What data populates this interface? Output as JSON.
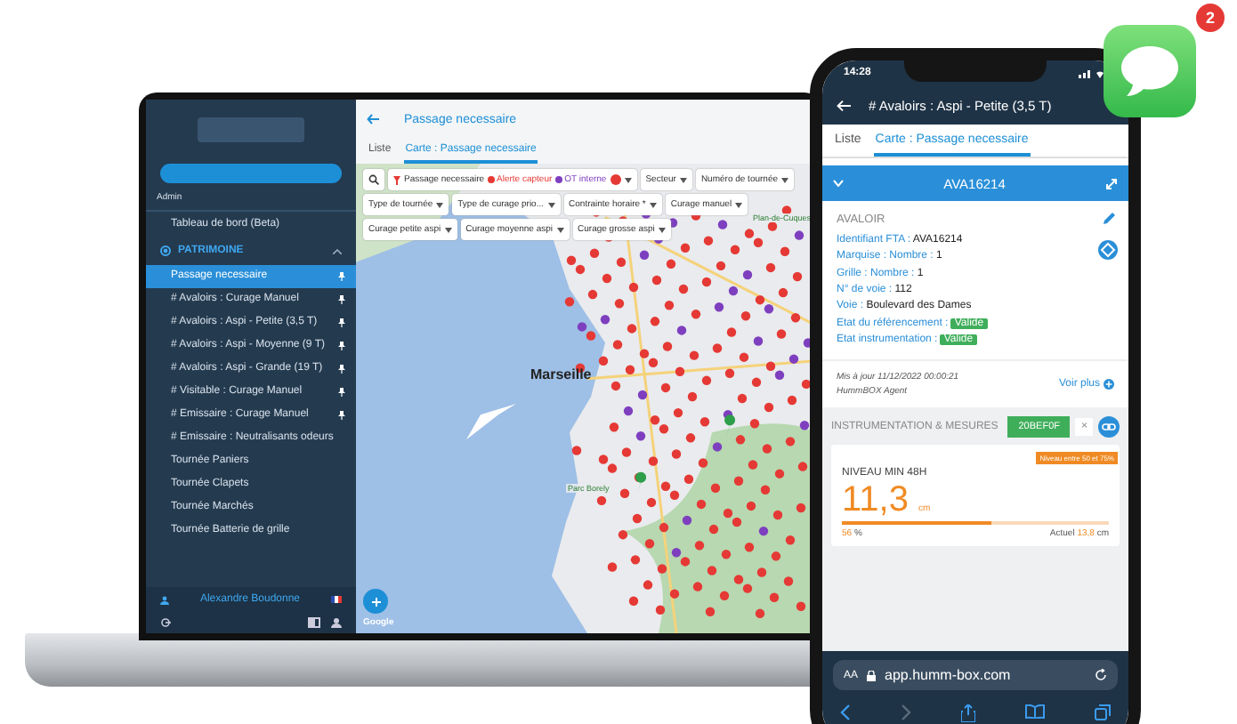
{
  "laptop": {
    "sidebar": {
      "admin_label": "Admin",
      "dashboard": "Tableau de bord (Beta)",
      "section": {
        "title": "PATRIMOINE",
        "expanded": true
      },
      "items": [
        {
          "label": "Passage necessaire",
          "selected": true,
          "pinned": true
        },
        {
          "label": "# Avaloirs : Curage Manuel",
          "selected": false,
          "pinned": true
        },
        {
          "label": "# Avaloirs : Aspi - Petite (3,5 T)",
          "selected": false,
          "pinned": true
        },
        {
          "label": "# Avaloirs : Aspi - Moyenne (9 T)",
          "selected": false,
          "pinned": true
        },
        {
          "label": "# Avaloirs : Aspi - Grande (19 T)",
          "selected": false,
          "pinned": true
        },
        {
          "label": "# Visitable : Curage Manuel",
          "selected": false,
          "pinned": true
        },
        {
          "label": "# Emissaire : Curage Manuel",
          "selected": false,
          "pinned": true
        },
        {
          "label": "# Emissaire : Neutralisants odeurs",
          "selected": false,
          "pinned": false
        },
        {
          "label": "Tournée Paniers",
          "selected": false,
          "pinned": false
        },
        {
          "label": "Tournée Clapets",
          "selected": false,
          "pinned": false
        },
        {
          "label": "Tournée Marchés",
          "selected": false,
          "pinned": false
        },
        {
          "label": "Tournée Batterie de grille",
          "selected": false,
          "pinned": false
        }
      ],
      "user": "Alexandre Boudonne"
    },
    "page": {
      "title": "Passage necessaire",
      "tabs": [
        {
          "label": "Liste",
          "selected": false
        },
        {
          "label": "Carte : Passage necessaire",
          "selected": true
        }
      ],
      "filters": [
        {
          "kind": "search"
        },
        {
          "kind": "legend",
          "label": "Passage necessaire",
          "legend": [
            {
              "label": "Alerte capteur",
              "color": "#e53935"
            },
            {
              "label": "OT interne",
              "color": "#7e3fbf"
            }
          ]
        },
        {
          "kind": "dropdown",
          "label": "Secteur"
        },
        {
          "kind": "dropdown",
          "label": "Numéro de tournée"
        },
        {
          "kind": "dropdown",
          "label": "Type de tournée"
        },
        {
          "kind": "dropdown",
          "label": "Type de curage prio..."
        },
        {
          "kind": "dropdown",
          "label": "Contrainte horaire *"
        },
        {
          "kind": "dropdown",
          "label": "Curage manuel"
        },
        {
          "kind": "dropdown",
          "label": "Curage petite aspi"
        },
        {
          "kind": "dropdown",
          "label": "Curage moyenne aspi"
        },
        {
          "kind": "dropdown",
          "label": "Curage grosse aspi"
        }
      ],
      "map": {
        "city_label": "Marseille",
        "place_labels": [
          "Plan-de-Cuques",
          "Parc Borely"
        ],
        "attribution": "Google"
      }
    }
  },
  "phone": {
    "status_bar": {
      "time": "14:28"
    },
    "header": {
      "title": "# Avaloirs : Aspi - Petite (3,5 T)"
    },
    "tabs": [
      {
        "label": "Liste",
        "selected": false
      },
      {
        "label": "Carte : Passage necessaire",
        "selected": true
      }
    ],
    "record": {
      "id": "AVA16214",
      "expanded": true,
      "type": "AVALOIR",
      "fields": [
        {
          "label": "Identifiant FTA :",
          "value": "AVA16214",
          "kind": "text"
        },
        {
          "label": "Marquise : Nombre :",
          "value": "1",
          "kind": "text"
        },
        {
          "label": "Grille : Nombre :",
          "value": "1",
          "kind": "text"
        },
        {
          "label": "N° de voie :",
          "value": "112",
          "kind": "text"
        },
        {
          "label": "Voie :",
          "value": "Boulevard des Dames",
          "kind": "text"
        },
        {
          "label": "Etat du référencement :",
          "value": "Valide",
          "kind": "badge"
        },
        {
          "label": "Etat instrumentation :",
          "value": "Valide",
          "kind": "badge"
        }
      ],
      "updated": "Mis à jour 11/12/2022 00:00:21",
      "agent": "HummBOX Agent",
      "more_link": "Voir plus"
    },
    "instrumentation": {
      "title": "INSTRUMENTATION & MESURES",
      "sensor_chip": "20BEF0F",
      "remove": "×",
      "measure": {
        "status_tag": "Niveau entre 50 et 75%",
        "title": "NIVEAU MIN 48H",
        "value": "11,3",
        "unit": "cm",
        "level": 0.56,
        "percent": "56",
        "percent_unit": "%",
        "current_label": "Actuel",
        "current_value": "13,8",
        "current_unit": "cm"
      }
    },
    "browser": {
      "text_size": "AA",
      "url": "app.humm-box.com"
    }
  },
  "notification": {
    "count": "2"
  }
}
